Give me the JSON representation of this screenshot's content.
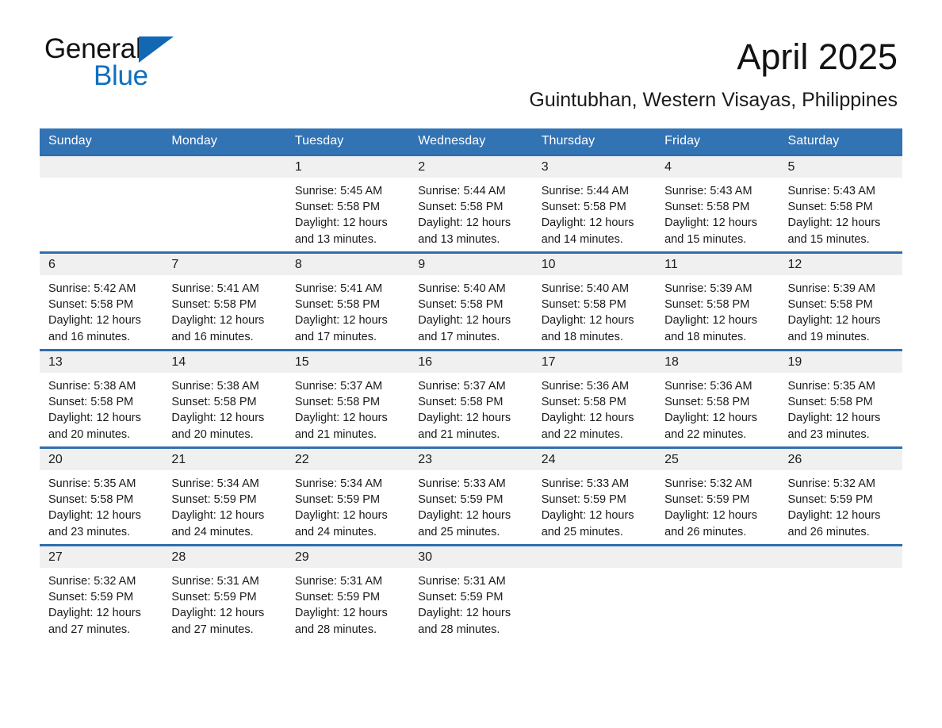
{
  "brand": {
    "name_part1": "General",
    "name_part2": "Blue",
    "accent_color": "#0d6fc0",
    "triangle_color": "#1268b3"
  },
  "header": {
    "month_title": "April 2025",
    "location": "Guintubhan, Western Visayas, Philippines"
  },
  "calendar": {
    "header_background": "#3273b4",
    "row_separator_color": "#2f6fae",
    "daynum_band_color": "#f0f0f0",
    "weekday_headers": [
      "Sunday",
      "Monday",
      "Tuesday",
      "Wednesday",
      "Thursday",
      "Friday",
      "Saturday"
    ],
    "weeks": [
      [
        {
          "day": "",
          "blank": true
        },
        {
          "day": "",
          "blank": true
        },
        {
          "day": "1",
          "sunrise": "Sunrise: 5:45 AM",
          "sunset": "Sunset: 5:58 PM",
          "daylight": "Daylight: 12 hours and 13 minutes."
        },
        {
          "day": "2",
          "sunrise": "Sunrise: 5:44 AM",
          "sunset": "Sunset: 5:58 PM",
          "daylight": "Daylight: 12 hours and 13 minutes."
        },
        {
          "day": "3",
          "sunrise": "Sunrise: 5:44 AM",
          "sunset": "Sunset: 5:58 PM",
          "daylight": "Daylight: 12 hours and 14 minutes."
        },
        {
          "day": "4",
          "sunrise": "Sunrise: 5:43 AM",
          "sunset": "Sunset: 5:58 PM",
          "daylight": "Daylight: 12 hours and 15 minutes."
        },
        {
          "day": "5",
          "sunrise": "Sunrise: 5:43 AM",
          "sunset": "Sunset: 5:58 PM",
          "daylight": "Daylight: 12 hours and 15 minutes."
        }
      ],
      [
        {
          "day": "6",
          "sunrise": "Sunrise: 5:42 AM",
          "sunset": "Sunset: 5:58 PM",
          "daylight": "Daylight: 12 hours and 16 minutes."
        },
        {
          "day": "7",
          "sunrise": "Sunrise: 5:41 AM",
          "sunset": "Sunset: 5:58 PM",
          "daylight": "Daylight: 12 hours and 16 minutes."
        },
        {
          "day": "8",
          "sunrise": "Sunrise: 5:41 AM",
          "sunset": "Sunset: 5:58 PM",
          "daylight": "Daylight: 12 hours and 17 minutes."
        },
        {
          "day": "9",
          "sunrise": "Sunrise: 5:40 AM",
          "sunset": "Sunset: 5:58 PM",
          "daylight": "Daylight: 12 hours and 17 minutes."
        },
        {
          "day": "10",
          "sunrise": "Sunrise: 5:40 AM",
          "sunset": "Sunset: 5:58 PM",
          "daylight": "Daylight: 12 hours and 18 minutes."
        },
        {
          "day": "11",
          "sunrise": "Sunrise: 5:39 AM",
          "sunset": "Sunset: 5:58 PM",
          "daylight": "Daylight: 12 hours and 18 minutes."
        },
        {
          "day": "12",
          "sunrise": "Sunrise: 5:39 AM",
          "sunset": "Sunset: 5:58 PM",
          "daylight": "Daylight: 12 hours and 19 minutes."
        }
      ],
      [
        {
          "day": "13",
          "sunrise": "Sunrise: 5:38 AM",
          "sunset": "Sunset: 5:58 PM",
          "daylight": "Daylight: 12 hours and 20 minutes."
        },
        {
          "day": "14",
          "sunrise": "Sunrise: 5:38 AM",
          "sunset": "Sunset: 5:58 PM",
          "daylight": "Daylight: 12 hours and 20 minutes."
        },
        {
          "day": "15",
          "sunrise": "Sunrise: 5:37 AM",
          "sunset": "Sunset: 5:58 PM",
          "daylight": "Daylight: 12 hours and 21 minutes."
        },
        {
          "day": "16",
          "sunrise": "Sunrise: 5:37 AM",
          "sunset": "Sunset: 5:58 PM",
          "daylight": "Daylight: 12 hours and 21 minutes."
        },
        {
          "day": "17",
          "sunrise": "Sunrise: 5:36 AM",
          "sunset": "Sunset: 5:58 PM",
          "daylight": "Daylight: 12 hours and 22 minutes."
        },
        {
          "day": "18",
          "sunrise": "Sunrise: 5:36 AM",
          "sunset": "Sunset: 5:58 PM",
          "daylight": "Daylight: 12 hours and 22 minutes."
        },
        {
          "day": "19",
          "sunrise": "Sunrise: 5:35 AM",
          "sunset": "Sunset: 5:58 PM",
          "daylight": "Daylight: 12 hours and 23 minutes."
        }
      ],
      [
        {
          "day": "20",
          "sunrise": "Sunrise: 5:35 AM",
          "sunset": "Sunset: 5:58 PM",
          "daylight": "Daylight: 12 hours and 23 minutes."
        },
        {
          "day": "21",
          "sunrise": "Sunrise: 5:34 AM",
          "sunset": "Sunset: 5:59 PM",
          "daylight": "Daylight: 12 hours and 24 minutes."
        },
        {
          "day": "22",
          "sunrise": "Sunrise: 5:34 AM",
          "sunset": "Sunset: 5:59 PM",
          "daylight": "Daylight: 12 hours and 24 minutes."
        },
        {
          "day": "23",
          "sunrise": "Sunrise: 5:33 AM",
          "sunset": "Sunset: 5:59 PM",
          "daylight": "Daylight: 12 hours and 25 minutes."
        },
        {
          "day": "24",
          "sunrise": "Sunrise: 5:33 AM",
          "sunset": "Sunset: 5:59 PM",
          "daylight": "Daylight: 12 hours and 25 minutes."
        },
        {
          "day": "25",
          "sunrise": "Sunrise: 5:32 AM",
          "sunset": "Sunset: 5:59 PM",
          "daylight": "Daylight: 12 hours and 26 minutes."
        },
        {
          "day": "26",
          "sunrise": "Sunrise: 5:32 AM",
          "sunset": "Sunset: 5:59 PM",
          "daylight": "Daylight: 12 hours and 26 minutes."
        }
      ],
      [
        {
          "day": "27",
          "sunrise": "Sunrise: 5:32 AM",
          "sunset": "Sunset: 5:59 PM",
          "daylight": "Daylight: 12 hours and 27 minutes."
        },
        {
          "day": "28",
          "sunrise": "Sunrise: 5:31 AM",
          "sunset": "Sunset: 5:59 PM",
          "daylight": "Daylight: 12 hours and 27 minutes."
        },
        {
          "day": "29",
          "sunrise": "Sunrise: 5:31 AM",
          "sunset": "Sunset: 5:59 PM",
          "daylight": "Daylight: 12 hours and 28 minutes."
        },
        {
          "day": "30",
          "sunrise": "Sunrise: 5:31 AM",
          "sunset": "Sunset: 5:59 PM",
          "daylight": "Daylight: 12 hours and 28 minutes."
        },
        {
          "day": "",
          "blank": true
        },
        {
          "day": "",
          "blank": true
        },
        {
          "day": "",
          "blank": true
        }
      ]
    ]
  }
}
